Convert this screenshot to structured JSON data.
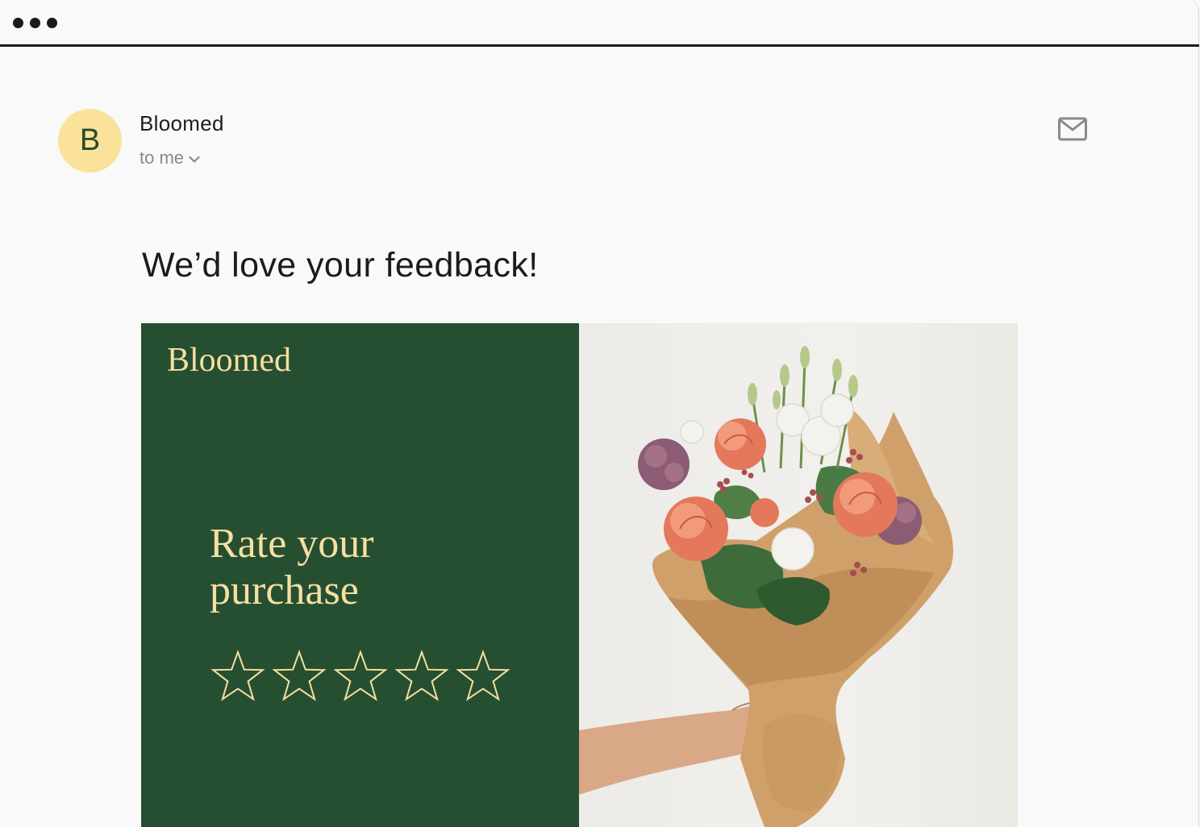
{
  "window": {
    "controls": [
      "dot",
      "dot",
      "dot"
    ]
  },
  "email": {
    "sender": {
      "avatar_letter": "B",
      "name": "Bloomed",
      "recipient": "to me"
    },
    "subject": "We’d love your feedback!"
  },
  "banner": {
    "brand": "Bloomed",
    "headline_line1": "Rate your",
    "headline_line2": "purchase",
    "rating": {
      "max": 5,
      "value": 0
    },
    "image_alt": "hand-holding-flower-bouquet"
  },
  "colors": {
    "banner_green": "#264f31",
    "accent_cream": "#f6dfa0",
    "avatar_bg": "#fbe29b"
  }
}
